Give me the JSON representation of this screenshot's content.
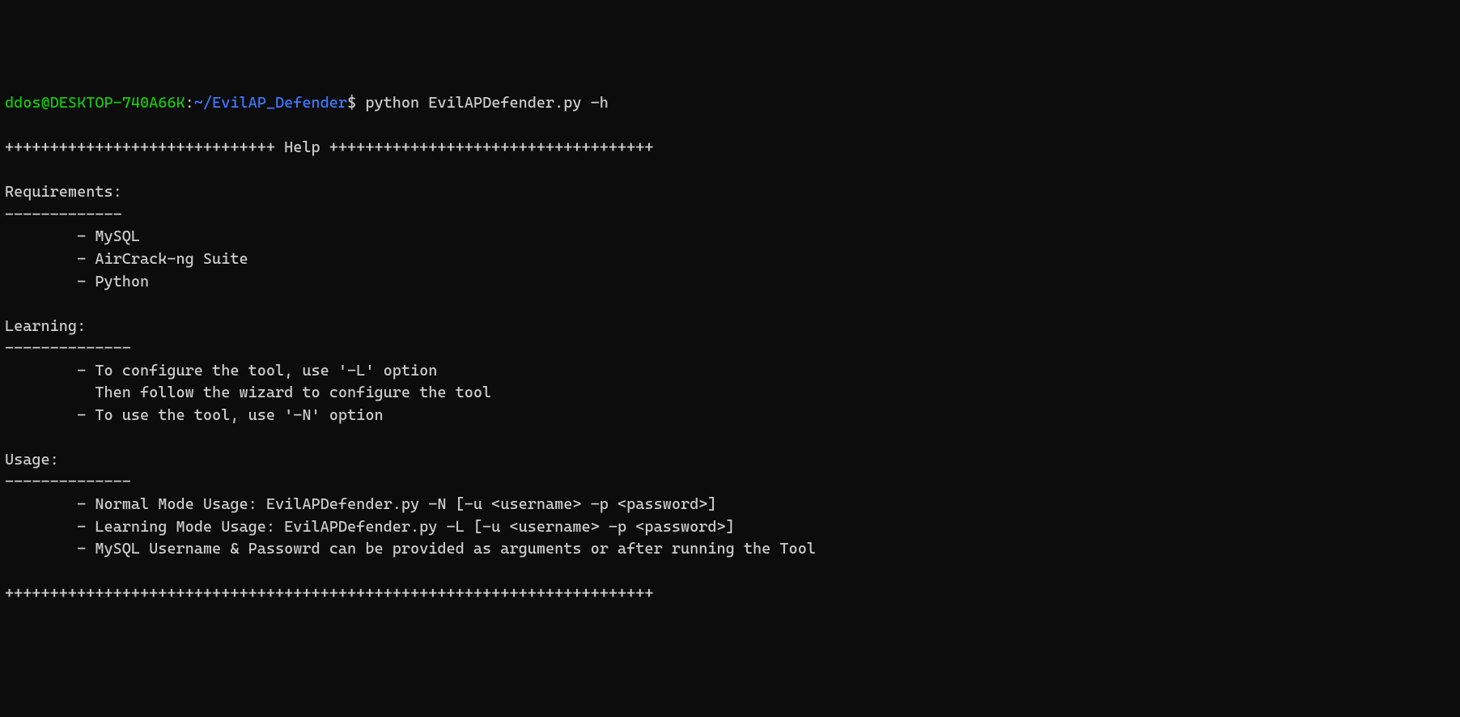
{
  "prompt": {
    "user": "ddos@DESKTOP-740A66K",
    "colon": ":",
    "path": "~/EvilAP_Defender",
    "dollar": "$",
    "command": " python EvilAPDefender.py -h"
  },
  "output": {
    "blank1": "",
    "header": "++++++++++++++++++++++++++++++ Help ++++++++++++++++++++++++++++++++++++",
    "blank2": "",
    "req_title": "Requirements:",
    "req_dashes": "-------------",
    "req1": "        - MySQL",
    "req2": "        - AirCrack-ng Suite",
    "req3": "        - Python",
    "blank3": "",
    "learn_title": "Learning:",
    "learn_dashes": "--------------",
    "learn1": "        - To configure the tool, use '-L' option",
    "learn2": "          Then follow the wizard to configure the tool",
    "learn3": "        - To use the tool, use '-N' option",
    "blank4": "",
    "usage_title": "Usage:",
    "usage_dashes": "--------------",
    "usage1": "        - Normal Mode Usage: EvilAPDefender.py -N [-u <username> -p <password>]",
    "usage2": "        - Learning Mode Usage: EvilAPDefender.py -L [-u <username> -p <password>]",
    "usage3": "        - MySQL Username & Passowrd can be provided as arguments or after running the Tool",
    "blank5": "",
    "footer": "++++++++++++++++++++++++++++++++++++++++++++++++++++++++++++++++++++++++"
  }
}
